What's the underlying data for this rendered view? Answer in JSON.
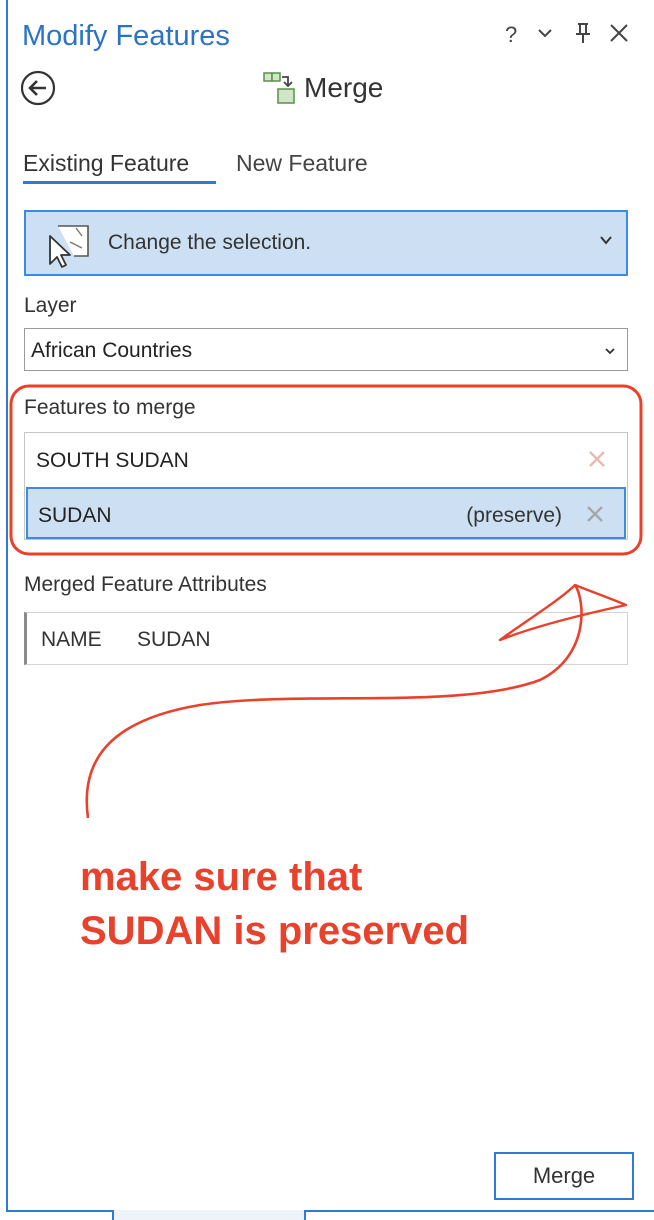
{
  "panel": {
    "title": "Modify Features",
    "controls": {
      "help": "?",
      "menu": "⌄",
      "pin": "⊥",
      "close": "✕"
    }
  },
  "tool": {
    "name": "Merge",
    "icon": "merge-icon"
  },
  "tabs": [
    {
      "label": "Existing Feature",
      "active": true
    },
    {
      "label": "New Feature",
      "active": false
    }
  ],
  "selection": {
    "label": "Change the selection.",
    "icon": "select-features-icon"
  },
  "layer": {
    "label": "Layer",
    "value": "African Countries"
  },
  "features_to_merge": {
    "label": "Features to merge",
    "items": [
      {
        "name": "SOUTH SUDAN",
        "tag": "",
        "selected": false
      },
      {
        "name": "SUDAN",
        "tag": "(preserve)",
        "selected": true
      }
    ]
  },
  "merged_attributes": {
    "label": "Merged Feature Attributes",
    "rows": [
      {
        "field": "NAME",
        "value": "SUDAN"
      }
    ]
  },
  "actions": {
    "merge": "Merge"
  },
  "annotation": {
    "lines": [
      "make sure that",
      "SUDAN is preserved"
    ],
    "color": "#e8412c"
  },
  "colors": {
    "accent": "#2f7bd1",
    "selection_fill": "#cde0f3",
    "annotation": "#e8412c"
  }
}
